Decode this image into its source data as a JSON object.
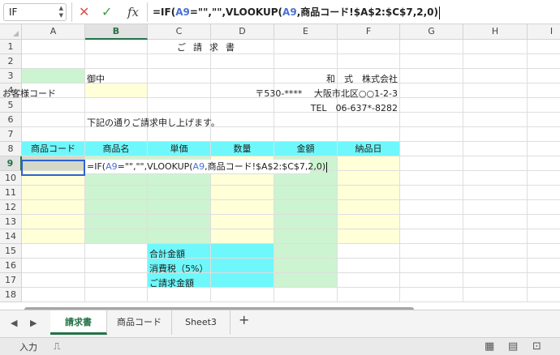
{
  "formula_bar": {
    "name_box": "IF",
    "formula_prefix": "=IF(",
    "formula_ref1": "A9",
    "formula_mid": "=\"\",\"\",VLOOKUP(",
    "formula_ref2": "A9",
    "formula_rest": ",商品コード!$A$2:$C$7,2,0)"
  },
  "columns": [
    "A",
    "B",
    "C",
    "D",
    "E",
    "F",
    "G",
    "H",
    "I"
  ],
  "rows": [
    "1",
    "2",
    "3",
    "4",
    "5",
    "6",
    "7",
    "8",
    "9",
    "10",
    "11",
    "12",
    "13",
    "14",
    "15",
    "16",
    "17",
    "18"
  ],
  "sheet": {
    "title": "ご請求書",
    "to_suffix": "御中",
    "customer_code_label": "お客様コード",
    "company": "和　式　株式会社",
    "address": "〒530-****　 大阪市北区○○1-2-3",
    "tel": "TEL　06-637*-8282",
    "greeting": "下記の通りご請求申し上げます。",
    "headers": [
      "商品コード",
      "商品名",
      "単価",
      "数量",
      "金額",
      "納品日"
    ],
    "subtotal_label": "合計金額",
    "tax_label": "消費税（5%）",
    "total_label": "ご請求金額"
  },
  "tabs": {
    "items": [
      "請求書",
      "商品コード",
      "Sheet3"
    ],
    "add_label": "+"
  },
  "status": {
    "mode": "入力"
  },
  "colors": {
    "accent": "#217346",
    "selection": "#2f62d6",
    "input_fill": "#ffffd8",
    "calc_fill": "#cdf4d0",
    "header_fill": "#6ff8fb"
  }
}
